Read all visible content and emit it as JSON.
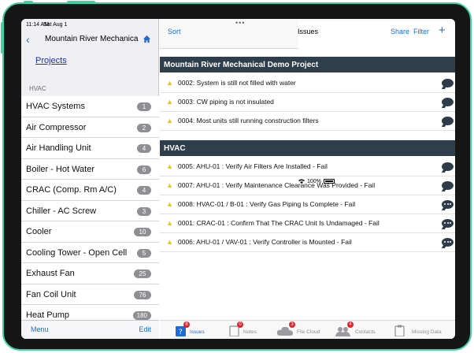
{
  "status": {
    "time": "11:14 AM",
    "date": "Sat Aug 1",
    "battery": "100%"
  },
  "left": {
    "nav_title": "Mountain River Mechanica",
    "projects_link": "Projects",
    "section_header": "HVAC",
    "items": [
      {
        "label": "HVAC Systems",
        "count": "1"
      },
      {
        "label": "Air Compressor",
        "count": "2"
      },
      {
        "label": "Air Handling Unit",
        "count": "4"
      },
      {
        "label": "Boiler - Hot Water",
        "count": "6"
      },
      {
        "label": "CRAC (Comp. Rm A/C)",
        "count": "4"
      },
      {
        "label": "Chiller - AC Screw",
        "count": "3"
      },
      {
        "label": "Cooler",
        "count": "10"
      },
      {
        "label": "Cooling Tower - Open Cell",
        "count": "5"
      },
      {
        "label": "Exhaust Fan",
        "count": "25"
      },
      {
        "label": "Fan Coil Unit",
        "count": "76"
      },
      {
        "label": "Heat Pump",
        "count": "180"
      }
    ],
    "toolbar": {
      "menu": "Menu",
      "edit": "Edit"
    }
  },
  "right": {
    "nav": {
      "sort": "Sort",
      "title": "Issues",
      "share": "Share",
      "filter": "Filter",
      "add": "+"
    },
    "groups": [
      {
        "title": "Mountain River Mechanical Demo Project",
        "issues": [
          "0002: System is still not filled with water",
          "0003: CW piping is not insulated",
          "0004: Most units still running construction filters"
        ]
      },
      {
        "title": "HVAC",
        "issues": [
          "0005: AHU-01 : Verify Air Filters Are Installed - Fail",
          "0007: AHU-01 : Verify Maintenance Clearance Was Provided - Fail",
          "0008: HVAC-01 / B-01 : Verify Gas Piping Is Complete - Fail",
          "0001: CRAC-01 : Confirm That The CRAC Unit  Is Undamaged - Fail",
          "0006: AHU-01 / VAV-01 : Verify Controller is Mounted - Fail"
        ]
      }
    ],
    "tabs": [
      {
        "label": "Issues",
        "badge": "8",
        "icon": "issues-icon"
      },
      {
        "label": "Notes",
        "badge": "0",
        "icon": "notes-icon"
      },
      {
        "label": "File Cloud",
        "badge": "3",
        "icon": "cloud-icon"
      },
      {
        "label": "Contacts",
        "badge": "4",
        "icon": "contacts-icon"
      },
      {
        "label": "Missing Data",
        "badge": "",
        "icon": "clipboard-icon"
      }
    ]
  },
  "colors": {
    "accent": "#1e6bd6",
    "header_bg": "#2e3e4a",
    "warning": "#f5c400",
    "badge": "#e0242c",
    "frame": "#3fd1a6"
  }
}
